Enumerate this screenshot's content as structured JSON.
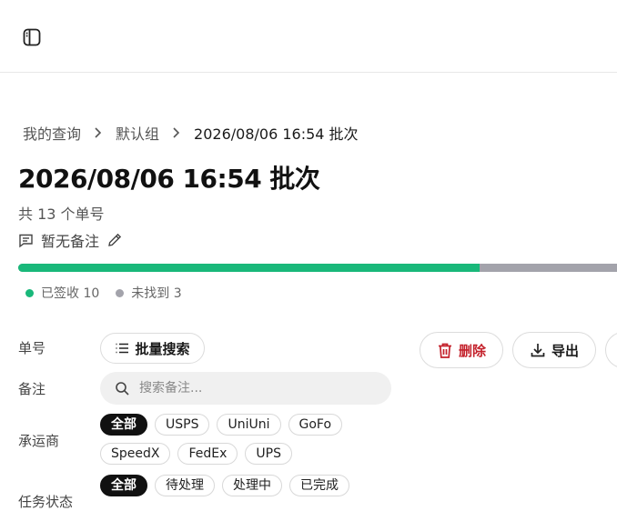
{
  "header": {
    "sidebar_toggle_icon": "sidebar-panel-icon"
  },
  "breadcrumb": {
    "items": [
      "我的查询",
      "默认组",
      "2026/08/06 16:54 批次"
    ]
  },
  "page": {
    "title": "2026/08/06 16:54 批次",
    "count_text": "共 13 个单号",
    "note_text": "暂无备注"
  },
  "progress": {
    "delivered_fraction": 0.77,
    "colors": {
      "delivered": "#19b87a",
      "not_found": "#a3a3ab"
    }
  },
  "legend": {
    "delivered": "已签收 10",
    "not_found": "未找到 3"
  },
  "filters": {
    "tracking_label": "单号",
    "batch_search_label": "批量搜索",
    "note_label": "备注",
    "note_search_placeholder": "搜索备注...",
    "carrier_label": "承运商",
    "carriers": [
      "全部",
      "USPS",
      "UniUni",
      "GoFo",
      "SpeedX",
      "FedEx",
      "UPS"
    ],
    "status_label": "任务状态",
    "statuses": [
      "全部",
      "待处理",
      "处理中",
      "已完成"
    ]
  },
  "actions": {
    "delete_label": "删除",
    "export_label": "导出",
    "delete_color": "#c4222c"
  }
}
